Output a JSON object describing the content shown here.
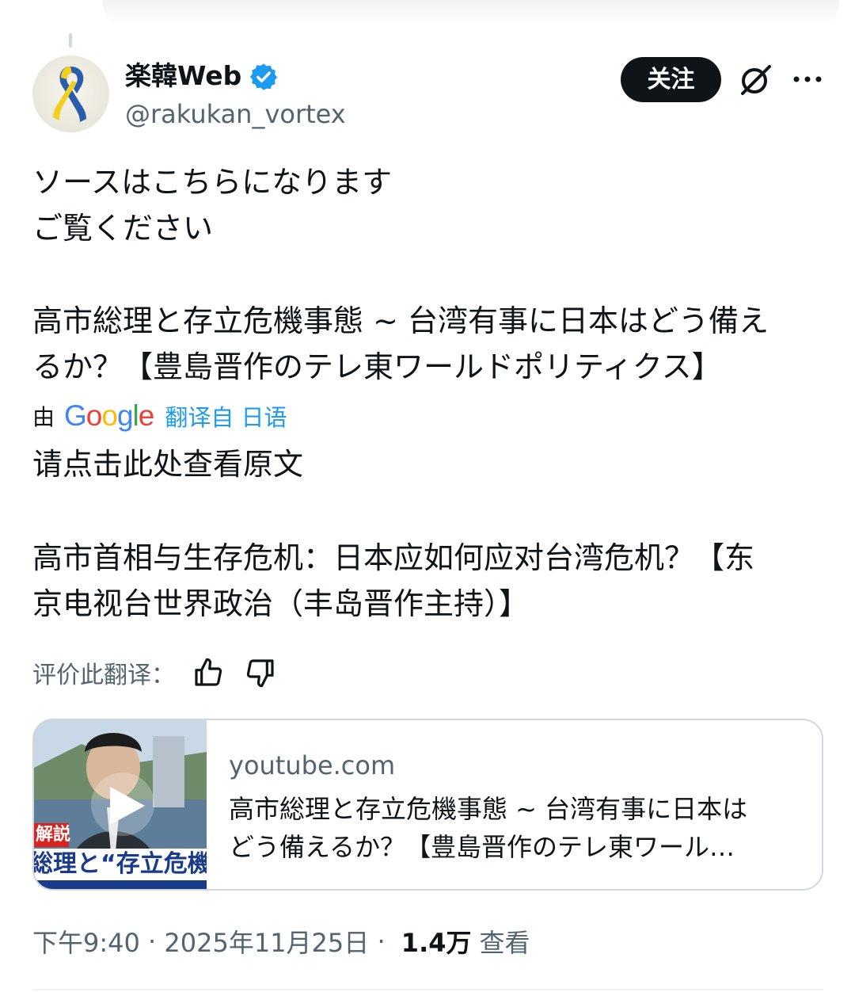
{
  "tweet": {
    "author": {
      "display_name": "楽韓Web",
      "handle": "@rakukan_vortex",
      "verified": true
    },
    "follow_label": "关注",
    "original_text": {
      "line1": "ソースはこちらになります",
      "line2": "ご覧ください",
      "line3": "高市総理と存立危機事態 ~ 台湾有事に日本はどう備え",
      "line4": "るか？【豊島晋作のテレ東ワールドポリティクス】"
    },
    "translation": {
      "by_label": "由",
      "provider": "Google",
      "translated_from": "翻译自 日语",
      "show_original": "请点击此处查看原文",
      "line1": "高市首相与生存危机：日本应如何应对台湾危机？【东",
      "line2": "京电视台世界政治（丰岛晋作主持）】",
      "rate_label": "评价此翻译："
    },
    "link_card": {
      "domain": "youtube.com",
      "title_line1": "高市総理と存立危機事態 ~ 台湾有事に日本は",
      "title_line2": "どう備えるか？【豊島晋作のテレ東ワール…",
      "thumbnail_caption_tag": "解説",
      "thumbnail_caption": "総理と“存立危機事"
    },
    "meta": {
      "time": "下午9:40",
      "separator": " · ",
      "date": "2025年11月25日",
      "separator2": " · ",
      "views": "1.4万",
      "views_label": "查看"
    }
  },
  "colors": {
    "text_primary": "#0f1419",
    "text_secondary": "#536471",
    "accent_blue": "#1d9bf0",
    "verified_blue": "#1d9bf0",
    "border": "#cfd9de"
  },
  "icons": [
    "verified-badge-icon",
    "grok-icon",
    "more-icon",
    "thumbs-up-icon",
    "thumbs-down-icon",
    "play-icon"
  ]
}
